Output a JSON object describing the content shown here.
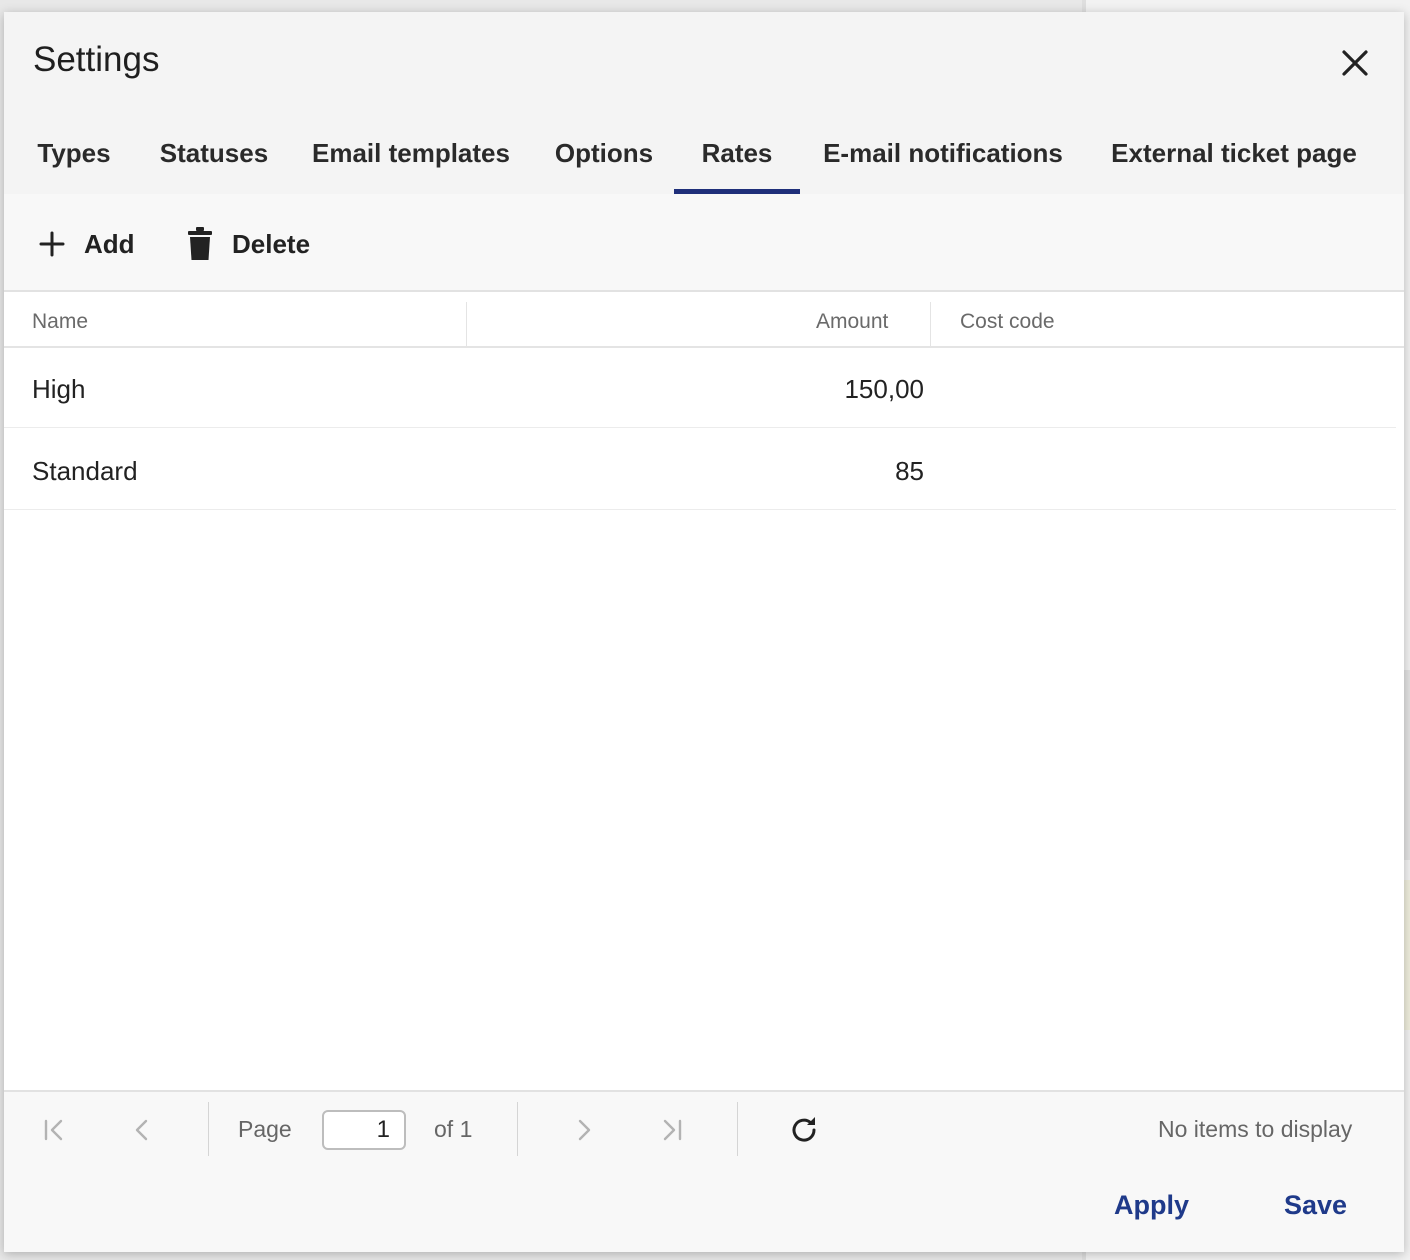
{
  "dialog": {
    "title": "Settings"
  },
  "tabs": [
    {
      "label": "Types"
    },
    {
      "label": "Statuses"
    },
    {
      "label": "Email templates"
    },
    {
      "label": "Options"
    },
    {
      "label": "Rates",
      "active": true
    },
    {
      "label": "E-mail notifications"
    },
    {
      "label": "External ticket page"
    }
  ],
  "toolbar": {
    "add_label": "Add",
    "delete_label": "Delete"
  },
  "grid": {
    "columns": [
      "Name",
      "Amount",
      "Cost code"
    ],
    "rows": [
      {
        "name": "High",
        "amount": "150,00",
        "cost_code": ""
      },
      {
        "name": "Standard",
        "amount": "85",
        "cost_code": ""
      }
    ]
  },
  "pager": {
    "page_label": "Page",
    "page_value": "1",
    "of_label": "of 1",
    "status": "No items to display"
  },
  "footer": {
    "apply_label": "Apply",
    "save_label": "Save"
  },
  "colors": {
    "accent": "#1f2f7a",
    "link": "#1f3a8a"
  }
}
